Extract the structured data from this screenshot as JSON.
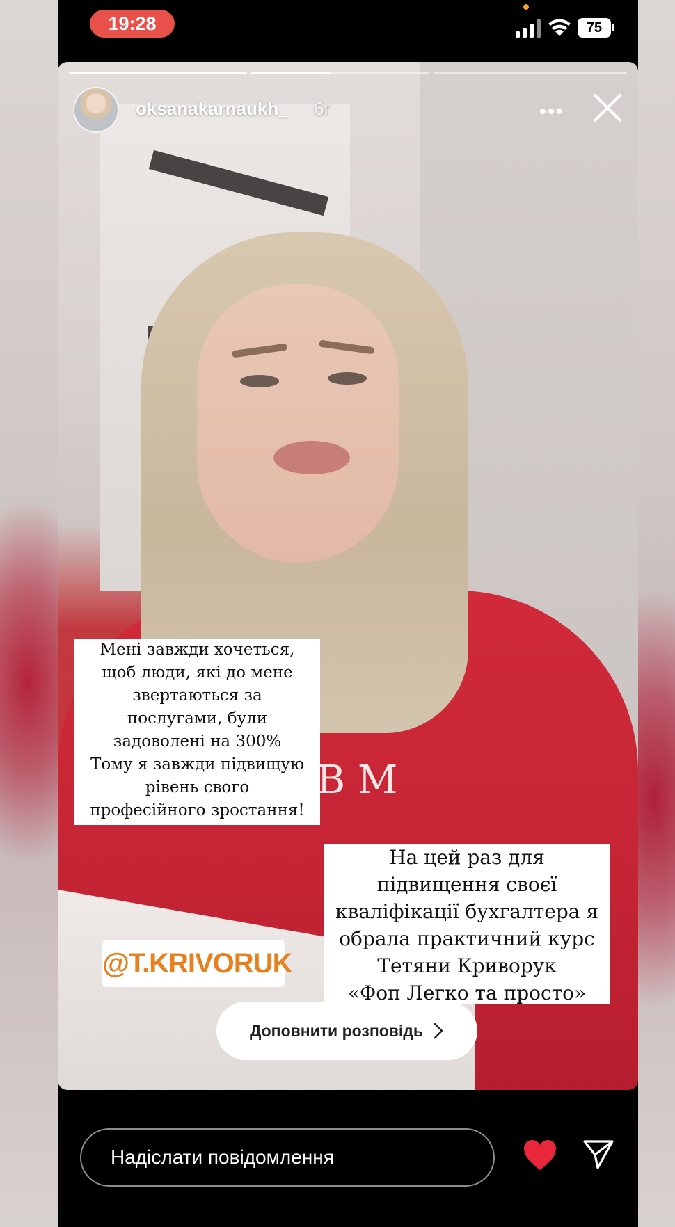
{
  "status_bar": {
    "time": "19:28",
    "battery": "75"
  },
  "story": {
    "progress": [
      1,
      0.45,
      0
    ],
    "username": "oksanakarnaukh_",
    "age": "6г",
    "caption_1": [
      "Мені завжди хочеться,",
      "щоб люди, які до мене",
      "звертаються за",
      "послугами, були",
      "задоволені на 300%",
      "Тому я завжди підвищую",
      "рівень свого",
      "професійного зростання!"
    ],
    "caption_2": [
      "На цей раз для",
      "підвищення своєї",
      "кваліфікації бухгалтера я",
      "обрала практичний курс",
      "Тетяни Криворук",
      "«Фоп Легко та просто»"
    ],
    "mention": "@T.KRIVORUK",
    "sweater_mark": "B M",
    "reply_button": "Доповнити розповідь"
  },
  "bottom_bar": {
    "message_placeholder": "Надіслати повідомлення"
  },
  "colors": {
    "time_pill": "#e8504a",
    "heart": "#e8283a",
    "mention_text": "#e8801e"
  }
}
